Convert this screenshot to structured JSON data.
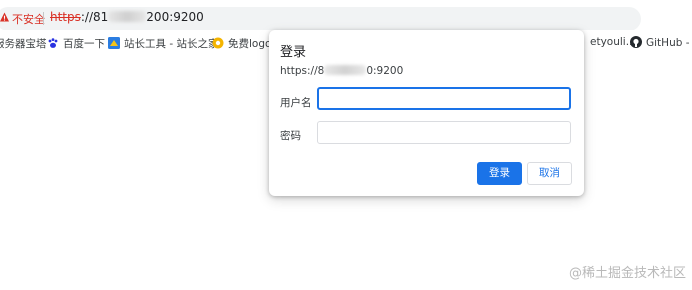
{
  "address_bar": {
    "security_label": "不安全",
    "url_scheme": "https",
    "url_prefix": "://81",
    "url_suffix": "200:9200"
  },
  "bookmarks": [
    {
      "label": "服务器宝塔",
      "icon": "page-icon"
    },
    {
      "label": "百度一下",
      "icon": "baidu-paw-icon"
    },
    {
      "label": "站长工具 - 站长之家",
      "icon": "chinaz-icon"
    },
    {
      "label": "免费logo在",
      "icon": "sun-flower-icon"
    },
    {
      "label": "etyouli...",
      "icon": "page-icon"
    },
    {
      "label": "GitHub - ja",
      "icon": "github-icon"
    }
  ],
  "dialog": {
    "title": "登录",
    "origin_prefix": "https://8",
    "origin_suffix": "0:9200",
    "username_label": "用户名",
    "username_value": "",
    "password_label": "密码",
    "password_value": "",
    "login_button": "登录",
    "cancel_button": "取消"
  },
  "watermark": "@稀土掘金技术社区",
  "colors": {
    "accent": "#1a73e8",
    "insecure": "#d93025"
  }
}
